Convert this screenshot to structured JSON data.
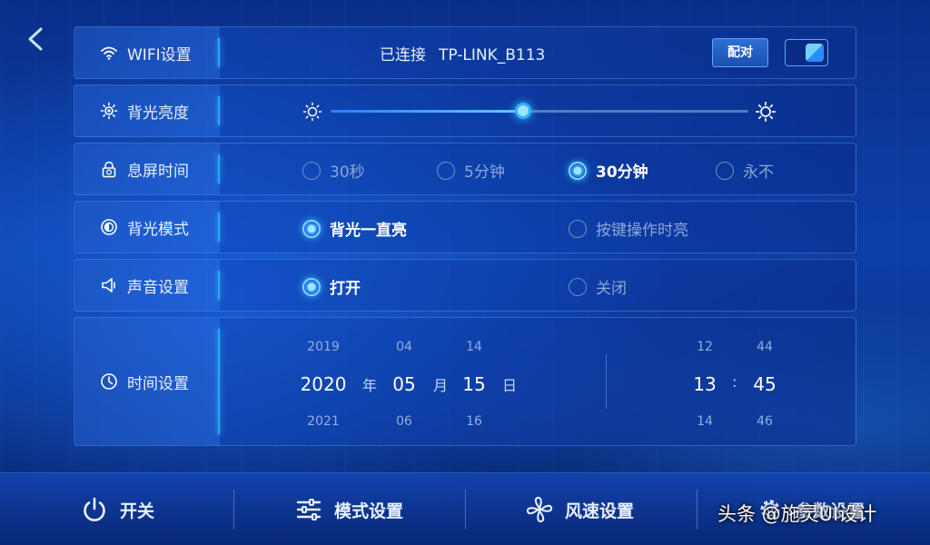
{
  "wifi": {
    "label": "WIFI设置",
    "status": "已连接",
    "network": "TP-LINK_B113",
    "pair_button": "配对",
    "enabled": true
  },
  "brightness": {
    "label": "背光亮度",
    "level_percent": 46
  },
  "screen_timeout": {
    "label": "息屏时间",
    "options": [
      "30秒",
      "5分钟",
      "30分钟",
      "永不"
    ],
    "selected": "30分钟"
  },
  "backlight_mode": {
    "label": "背光模式",
    "options": [
      "背光一直亮",
      "按键操作时亮"
    ],
    "selected": "背光一直亮"
  },
  "sound": {
    "label": "声音设置",
    "options": [
      "打开",
      "关闭"
    ],
    "selected": "打开"
  },
  "time_setting": {
    "label": "时间设置",
    "year": {
      "prev": "2019",
      "current": "2020",
      "next": "2021",
      "unit": "年"
    },
    "month": {
      "prev": "04",
      "current": "05",
      "next": "06",
      "unit": "月"
    },
    "day": {
      "prev": "14",
      "current": "15",
      "next": "16",
      "unit": "日"
    },
    "hour": {
      "prev": "12",
      "current": "13",
      "next": "14"
    },
    "minute": {
      "prev": "44",
      "current": "45",
      "next": "46"
    },
    "colon": ":"
  },
  "bottom_nav": [
    {
      "label": "开关",
      "icon": "power-icon"
    },
    {
      "label": "模式设置",
      "icon": "sliders-icon"
    },
    {
      "label": "风速设置",
      "icon": "fan-icon"
    },
    {
      "label": "参数设置",
      "icon": "gear-icon"
    }
  ],
  "watermark": "头条 @施灵UI设计",
  "colors": {
    "accent": "#2aa6ff",
    "background": "#0c3fa8",
    "selected_text": "#ffffff",
    "muted_text": "#8ba8d6"
  }
}
